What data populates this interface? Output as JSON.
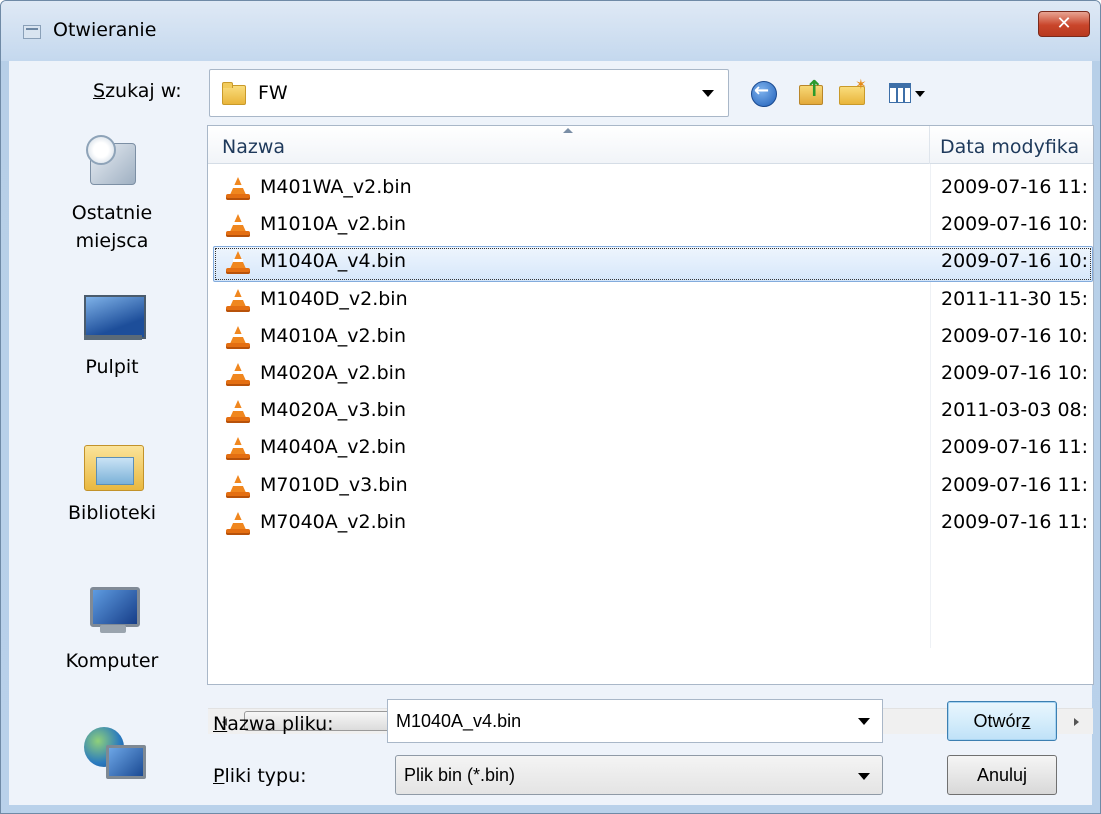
{
  "window": {
    "title": "Otwieranie",
    "close_label": "✕"
  },
  "lookin": {
    "label_prefix": "S",
    "label_rest": "zukaj w:",
    "value": "FW"
  },
  "toolbar": {
    "icons": [
      "back-icon",
      "up-folder-icon",
      "new-folder-icon",
      "views-icon"
    ]
  },
  "places": [
    {
      "label": "Ostatnie miejsca",
      "icon": "recent-places-icon"
    },
    {
      "label": "Pulpit",
      "icon": "desktop-icon"
    },
    {
      "label": "Biblioteki",
      "icon": "libraries-icon"
    },
    {
      "label": "Komputer",
      "icon": "computer-icon"
    },
    {
      "label": "",
      "icon": "network-icon"
    }
  ],
  "columns": {
    "name": "Nazwa",
    "date": "Data modyfika"
  },
  "files": [
    {
      "name": "M401WA_v2.bin",
      "date": "2009-07-16 11:"
    },
    {
      "name": "M1010A_v2.bin",
      "date": "2009-07-16 10:"
    },
    {
      "name": "M1040A_v4.bin",
      "date": "2009-07-16 10:"
    },
    {
      "name": "M1040D_v2.bin",
      "date": "2011-11-30 15:"
    },
    {
      "name": "M4010A_v2.bin",
      "date": "2009-07-16 10:"
    },
    {
      "name": "M4020A_v2.bin",
      "date": "2009-07-16 10:"
    },
    {
      "name": "M4020A_v3.bin",
      "date": "2011-03-03 08:"
    },
    {
      "name": "M4040A_v2.bin",
      "date": "2009-07-16 11:"
    },
    {
      "name": "M7010D_v3.bin",
      "date": "2009-07-16 11:"
    },
    {
      "name": "M7040A_v2.bin",
      "date": "2009-07-16 11:"
    }
  ],
  "selected_file": "M1040A_v4.bin",
  "scrollbar": {
    "grip": "III"
  },
  "filename": {
    "label_prefix": "N",
    "label_rest": "azwa pliku:",
    "value": "M1040A_v4.bin"
  },
  "filetype": {
    "label_prefix": "P",
    "label_rest": "liki typu:",
    "value": "Plik bin (*.bin)"
  },
  "buttons": {
    "open_main": "Otwór",
    "open_accel": "z",
    "cancel": "Anuluj"
  },
  "colors": {
    "selection_border": "#84acdd",
    "close_button": "#c9452a",
    "file_icon": "#f0871f"
  }
}
